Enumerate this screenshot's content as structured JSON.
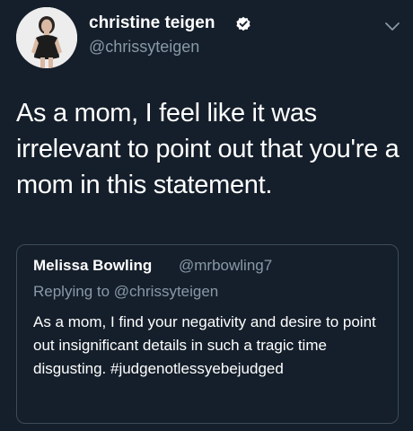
{
  "tweet": {
    "author_name": "christine teigen",
    "author_handle": "@chrissyteigen",
    "text": "As a mom, I feel like it was irrelevant to point out that you're a mom in this statement.",
    "avatar_icon": "profile-photo",
    "verified_icon": "verified-badge-icon",
    "menu_icon": "chevron-down-icon"
  },
  "quoted_tweet": {
    "author_name": "Melissa Bowling",
    "author_handle": "@mrbowling7",
    "replying_label": "Replying to",
    "replying_to": "@chrissyteigen",
    "text": "As a mom, I find your negativity and desire to point out insignificant details in such a tragic time disgusting. #judgenotlessyebejudged"
  },
  "colors": {
    "background": "#151f2b",
    "text_primary": "#ffffff",
    "text_secondary": "#8899a6",
    "border": "#3d4b59"
  }
}
